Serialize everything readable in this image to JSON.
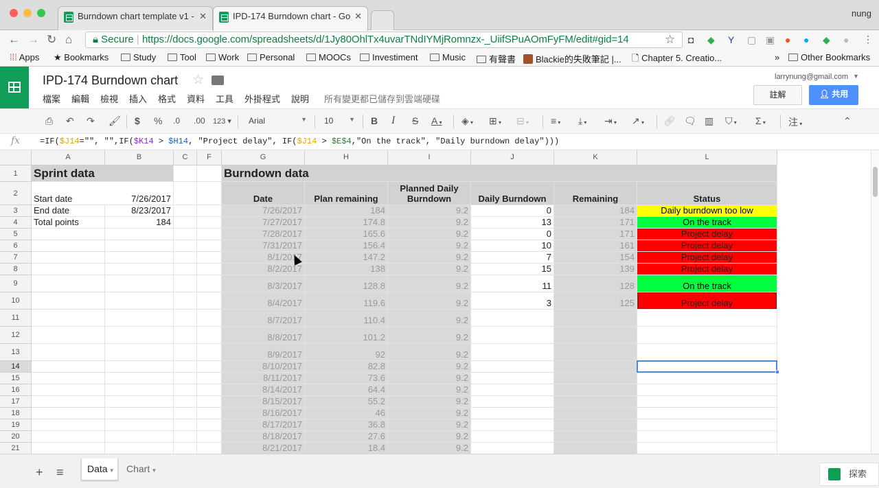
{
  "browser": {
    "user": "nung",
    "tabs": [
      {
        "title": "Burndown chart template v1 -",
        "active": false
      },
      {
        "title": "IPD-174 Burndown chart - Go",
        "active": true
      }
    ],
    "secure_label": "Secure",
    "url": "https://docs.google.com/spreadsheets/d/1Jy80OhlTx4uvarTNdIYMjRomnzx-_UiifSPuAOmFyFM/edit#gid=14",
    "bookmarks": [
      "Apps",
      "Bookmarks",
      "Study",
      "Tool",
      "Work",
      "Personal",
      "MOOCs",
      "Investiment",
      "Music",
      "有聲書",
      "Blackie的失敗筆記 |...",
      "Chapter 5. Creatio..."
    ],
    "more_bookmarks": "»",
    "other_bookmarks": "Other Bookmarks"
  },
  "doc": {
    "title": "IPD-174 Burndown chart",
    "menus": [
      "檔案",
      "編輯",
      "檢視",
      "插入",
      "格式",
      "資料",
      "工具",
      "外掛程式",
      "說明"
    ],
    "save_status": "所有變更都已儲存到雲端硬碟",
    "account": "larrynung@gmail.com",
    "comment_label": "註解",
    "share_label": "共用"
  },
  "toolbar": {
    "currency": "$",
    "percent": "%",
    "dec_less": ".0",
    "dec_more": ".00",
    "format_more": "123",
    "font": "Arial",
    "font_size": "10",
    "bold": "B",
    "italic": "I",
    "strike": "S",
    "text_color": "A",
    "input_tools": "注"
  },
  "formula_bar": {
    "fx": "fx",
    "parts": [
      "=IF(",
      "$J14",
      "=\"\", \"\",IF(",
      "$K14",
      " > ",
      "$H14",
      ", \"Project delay\", IF(",
      "$J14",
      " > ",
      "$E$4",
      ",\"On the track\", \"Daily burndown delay\")))"
    ]
  },
  "grid": {
    "columns": [
      "A",
      "B",
      "C",
      "F",
      "G",
      "H",
      "I",
      "J",
      "K",
      "L"
    ],
    "row_numbers": [
      "1",
      "2",
      "3",
      "4",
      "5",
      "6",
      "7",
      "8",
      "9",
      "10",
      "11",
      "12",
      "13",
      "14",
      "15",
      "16",
      "17",
      "18",
      "19",
      "20",
      "21"
    ],
    "sprint": {
      "title": "Sprint data",
      "rows": [
        {
          "label": "Start date",
          "value": "7/26/2017"
        },
        {
          "label": "End date",
          "value": "8/23/2017"
        },
        {
          "label": "Total points",
          "value": "184"
        }
      ]
    },
    "burndown": {
      "title": "Burndown data",
      "headers": [
        "Date",
        "Plan remaining",
        "Planned Daily Burndown",
        "Daily Burndown",
        "Remaining",
        "Status"
      ],
      "rows": [
        {
          "date": "7/26/2017",
          "plan": "184",
          "daily_plan": "9.2",
          "daily": "0",
          "remaining": "184",
          "status": "Daily burndown too low",
          "status_color": "#ffff00"
        },
        {
          "date": "7/27/2017",
          "plan": "174.8",
          "daily_plan": "9.2",
          "daily": "13",
          "remaining": "171",
          "status": "On the track",
          "status_color": "#00ff40"
        },
        {
          "date": "7/28/2017",
          "plan": "165.6",
          "daily_plan": "9.2",
          "daily": "0",
          "remaining": "171",
          "status": "Project delay",
          "status_color": "#ff0000"
        },
        {
          "date": "7/31/2017",
          "plan": "156.4",
          "daily_plan": "9.2",
          "daily": "10",
          "remaining": "161",
          "status": "Project delay",
          "status_color": "#ff0000"
        },
        {
          "date": "8/1/2017",
          "plan": "147.2",
          "daily_plan": "9.2",
          "daily": "7",
          "remaining": "154",
          "status": "Project delay",
          "status_color": "#ff0000"
        },
        {
          "date": "8/2/2017",
          "plan": "138",
          "daily_plan": "9.2",
          "daily": "15",
          "remaining": "139",
          "status": "Project delay",
          "status_color": "#ff0000"
        },
        {
          "date": "8/3/2017",
          "plan": "128.8",
          "daily_plan": "9.2",
          "daily": "11",
          "remaining": "128",
          "status": "On the track",
          "status_color": "#00ff40"
        },
        {
          "date": "8/4/2017",
          "plan": "119.6",
          "daily_plan": "9.2",
          "daily": "3",
          "remaining": "125",
          "status": "Project delay",
          "status_color": "#ff0000"
        },
        {
          "date": "8/7/2017",
          "plan": "110.4",
          "daily_plan": "9.2",
          "daily": "",
          "remaining": "",
          "status": "",
          "status_color": ""
        },
        {
          "date": "8/8/2017",
          "plan": "101.2",
          "daily_plan": "9.2",
          "daily": "",
          "remaining": "",
          "status": "",
          "status_color": ""
        },
        {
          "date": "8/9/2017",
          "plan": "92",
          "daily_plan": "9.2",
          "daily": "",
          "remaining": "",
          "status": "",
          "status_color": ""
        },
        {
          "date": "8/10/2017",
          "plan": "82.8",
          "daily_plan": "9.2",
          "daily": "",
          "remaining": "",
          "status": "",
          "status_color": ""
        },
        {
          "date": "8/11/2017",
          "plan": "73.6",
          "daily_plan": "9.2",
          "daily": "",
          "remaining": "",
          "status": "",
          "status_color": ""
        },
        {
          "date": "8/14/2017",
          "plan": "64.4",
          "daily_plan": "9.2",
          "daily": "",
          "remaining": "",
          "status": "",
          "status_color": ""
        },
        {
          "date": "8/15/2017",
          "plan": "55.2",
          "daily_plan": "9.2",
          "daily": "",
          "remaining": "",
          "status": "",
          "status_color": ""
        },
        {
          "date": "8/16/2017",
          "plan": "46",
          "daily_plan": "9.2",
          "daily": "",
          "remaining": "",
          "status": "",
          "status_color": ""
        },
        {
          "date": "8/17/2017",
          "plan": "36.8",
          "daily_plan": "9.2",
          "daily": "",
          "remaining": "",
          "status": "",
          "status_color": ""
        },
        {
          "date": "8/18/2017",
          "plan": "27.6",
          "daily_plan": "9.2",
          "daily": "",
          "remaining": "",
          "status": "",
          "status_color": ""
        },
        {
          "date": "8/21/2017",
          "plan": "18.4",
          "daily_plan": "9.2",
          "daily": "",
          "remaining": "",
          "status": "",
          "status_color": ""
        }
      ]
    }
  },
  "sheets": {
    "add": "+",
    "list": "≡",
    "tabs": [
      {
        "name": "Data",
        "active": true
      },
      {
        "name": "Chart",
        "active": false
      }
    ],
    "explore_label": "探索"
  }
}
